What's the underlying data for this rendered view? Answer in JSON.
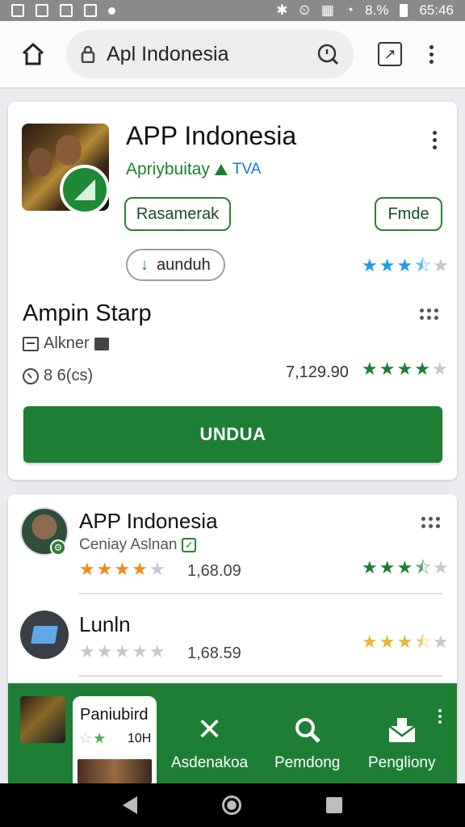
{
  "status_bar": {
    "battery": "8.%",
    "time": "65:46"
  },
  "browser": {
    "url": "Apl Indonesia"
  },
  "featured": {
    "title": "APP Indonesia",
    "developer": "Apriybuitay",
    "badge": "TVA",
    "btn_left": "Rasamerak",
    "btn_right": "Fmde",
    "download_label": "aunduh",
    "rating": 3.5,
    "section_title": "Ampin Starp",
    "meta_label": "Alkner",
    "meta_size": "8 6(cs)",
    "count": "7,129.90",
    "count_rating": 4,
    "install_label": "UNDUA"
  },
  "list": [
    {
      "title": "APP Indonesia",
      "subtitle": "Ceniay Aslnan",
      "rating": 4,
      "count": "1,68.09",
      "right_rating": 3.5
    },
    {
      "title": "Lunln",
      "subtitle": "",
      "rating": 0,
      "count": "1,68.59",
      "right_rating": 3.5
    }
  ],
  "bottom_bar": {
    "card_title": "Paniubird",
    "card_num": "10H",
    "items": [
      "Asdenakoa",
      "Pemdong",
      "Pengliony"
    ]
  },
  "colors": {
    "accent": "#1e7e34",
    "star_blue": "#1a9be8",
    "star_orange": "#f08c1a",
    "star_gold": "#e8b830"
  }
}
